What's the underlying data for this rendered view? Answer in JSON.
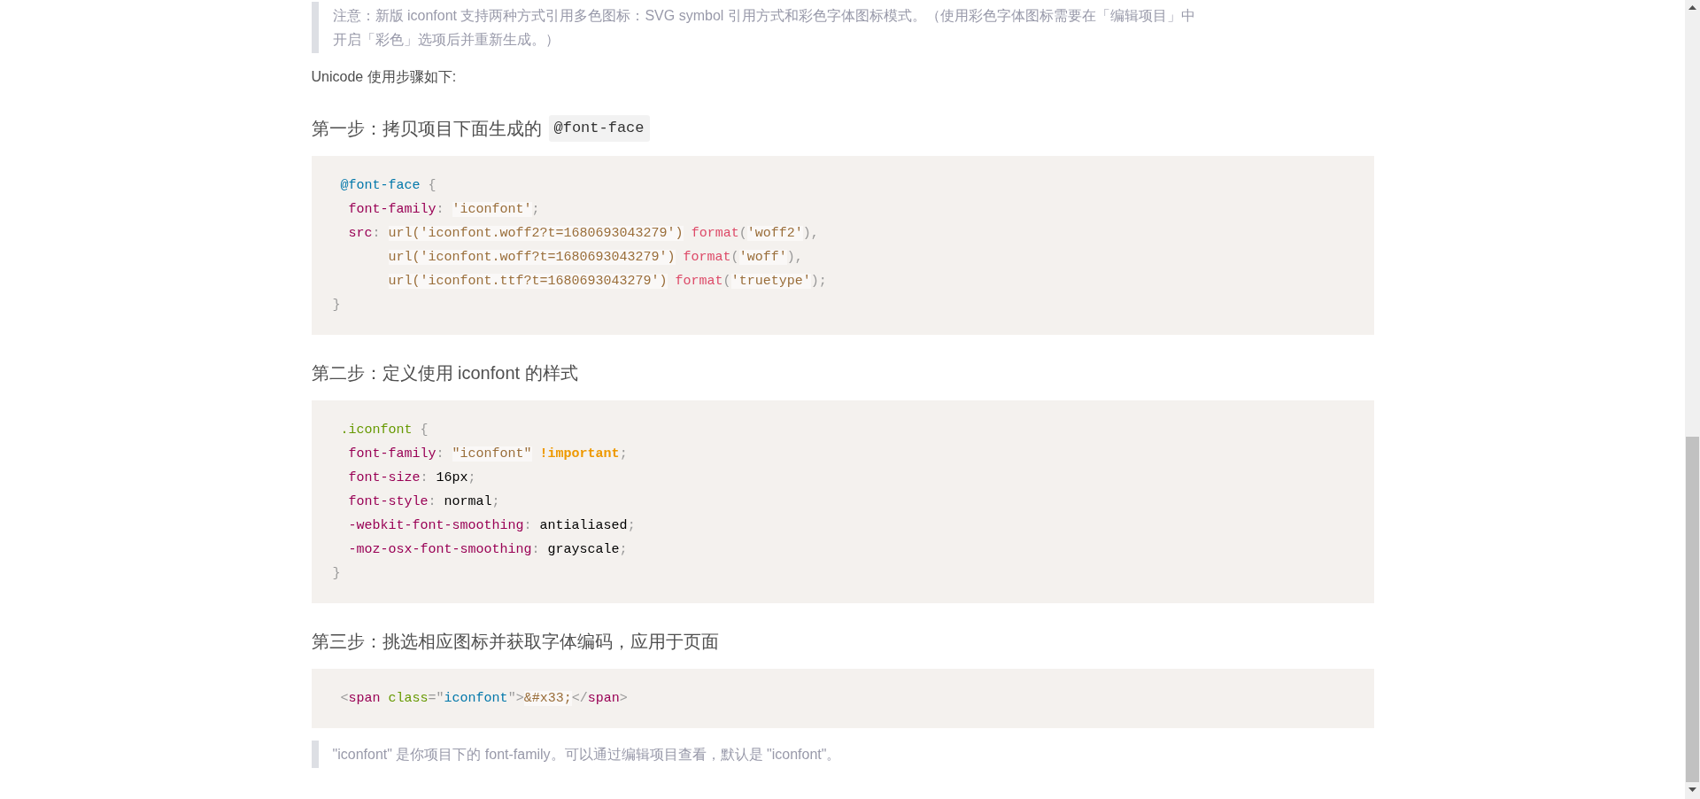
{
  "notice": {
    "lines": [
      "注意：新版 iconfont 支持两种方式引用多色图标：SVG symbol 引用方式和彩色字体图标模式。（使用彩色字体图标需要在「编辑项目」中",
      "开启「彩色」选项后并重新生成。）"
    ]
  },
  "intro": "Unicode 使用步骤如下:",
  "steps": [
    {
      "heading": [
        {
          "kind": "text",
          "text": "第一步：拷贝项目下面生成的"
        },
        {
          "kind": "code",
          "text": "@font-face"
        }
      ],
      "code": [
        " @font-face {",
        "  font-family: 'iconfont';",
        "  src: url('iconfont.woff2?t=1680693043279') format('woff2'),",
        "       url('iconfont.woff?t=1680693043279') format('woff'),",
        "       url('iconfont.ttf?t=1680693043279') format('truetype');",
        "}"
      ]
    },
    {
      "heading": [
        {
          "kind": "text",
          "text": "第二步：定义使用 iconfont 的样式"
        }
      ],
      "code": [
        " .iconfont {",
        "  font-family: \"iconfont\" !important;",
        "  font-size: 16px;",
        "  font-style: normal;",
        "  -webkit-font-smoothing: antialiased;",
        "  -moz-osx-font-smoothing: grayscale;",
        "}"
      ]
    },
    {
      "heading": [
        {
          "kind": "text",
          "text": "第三步：挑选相应图标并获取字体编码，应用于页面"
        }
      ],
      "code": [
        " <span class=\"iconfont\">&#x33;</span>"
      ]
    }
  ],
  "note": "\"iconfont\" 是你项目下的 font-family。可以通过编辑项目查看，默认是 \"iconfont\"。"
}
